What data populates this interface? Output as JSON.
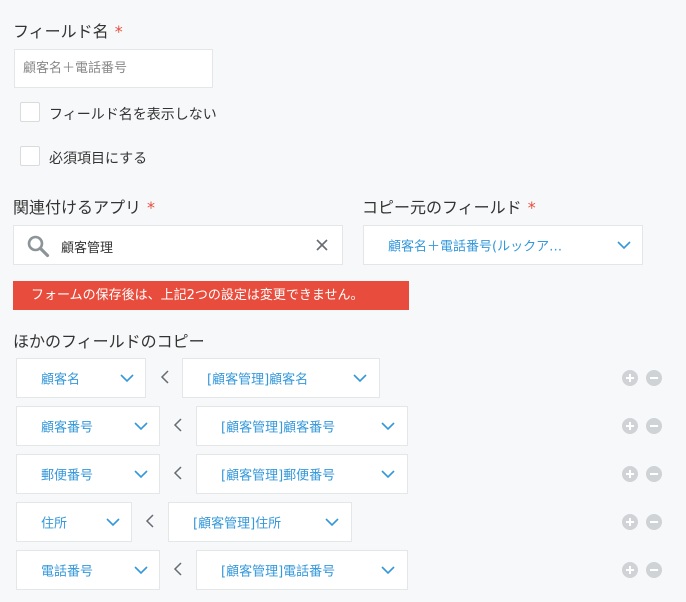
{
  "field_name": {
    "label": "フィールド名",
    "required_mark": "*",
    "placeholder": "顧客名＋電話番号"
  },
  "checkboxes": {
    "hide_field_name": "フィールド名を表示しない",
    "required_item": "必須項目にする"
  },
  "related_app": {
    "label": "関連付けるアプリ",
    "required_mark": "*",
    "value": "顧客管理"
  },
  "copy_source": {
    "label": "コピー元のフィールド",
    "required_mark": "*",
    "value": "顧客名＋電話番号(ルックア…"
  },
  "error_message": "フォームの保存後は、上記2つの設定は変更できません。",
  "other_copy": {
    "label": "ほかのフィールドのコピー",
    "rows": [
      {
        "dest": "顧客名",
        "src": "[顧客管理]顧客名"
      },
      {
        "dest": "顧客番号",
        "src": "[顧客管理]顧客番号"
      },
      {
        "dest": "郵便番号",
        "src": "[顧客管理]郵便番号"
      },
      {
        "dest": "住所",
        "src": "[顧客管理]住所"
      },
      {
        "dest": "電話番号",
        "src": "[顧客管理]電話番号"
      }
    ]
  },
  "icons": {
    "search": "search-icon",
    "clear": "close-icon",
    "dropdown": "chevron-down-icon",
    "arrow": "chevron-left-icon",
    "add": "plus-circle-icon",
    "remove": "minus-circle-icon"
  },
  "colors": {
    "required": "#e74c3c",
    "link": "#3498db",
    "error_bg": "#e74c3c",
    "background": "#f7f8fa"
  }
}
